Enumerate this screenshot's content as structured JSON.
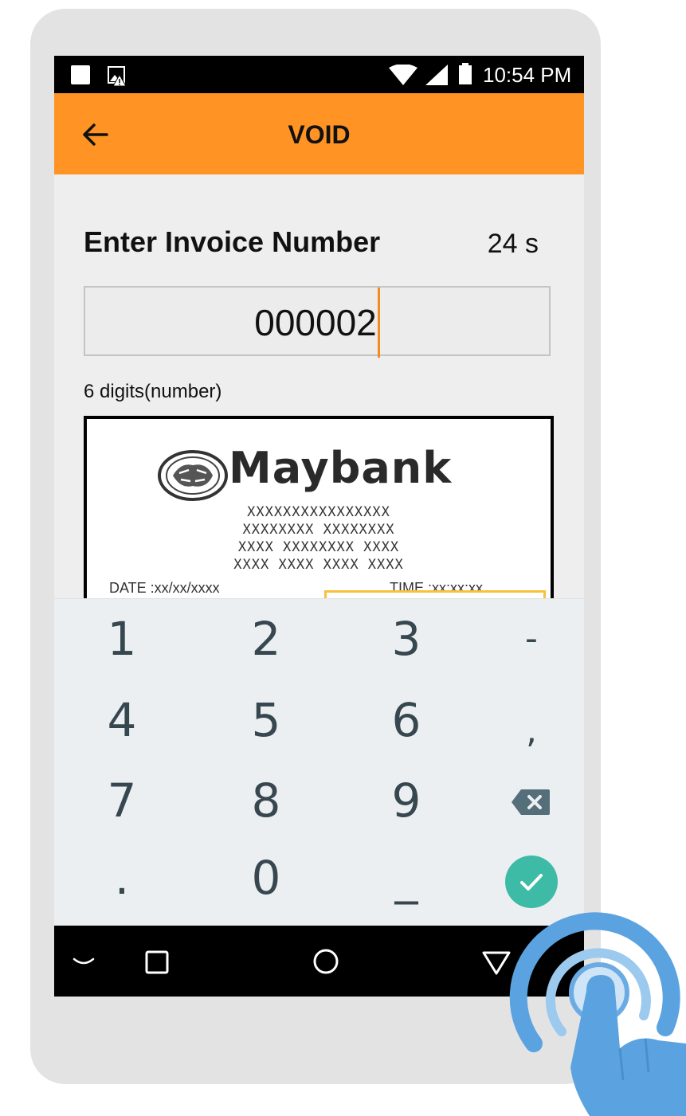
{
  "status_bar": {
    "time": "10:54 PM",
    "icons": [
      "notification-square-icon",
      "image-alert-icon",
      "wifi-icon",
      "cell-signal-icon",
      "battery-icon"
    ]
  },
  "app_bar": {
    "title": "VOID",
    "back_icon": "arrow-left-icon"
  },
  "form": {
    "prompt": "Enter Invoice Number",
    "timer": "24 s",
    "invoice_value": "000002",
    "hint": "6 digits(number)"
  },
  "receipt_preview": {
    "bank_name": "Maybank",
    "masked_lines": [
      "XXXXXXXXXXXXXXXX",
      "XXXXXXXX XXXXXXXX",
      "XXXX XXXXXXXX XXXX",
      "XXXX XXXX XXXX XXXX"
    ],
    "date_label": "DATE :xx/xx/xxxx",
    "time_label": "TIME :xx:xx:xx"
  },
  "keypad": {
    "keys": [
      "1",
      "2",
      "3",
      "-",
      "4",
      "5",
      "6",
      ",",
      "7",
      "8",
      "9",
      ".",
      "0",
      "_"
    ],
    "backspace_icon": "backspace-icon",
    "enter_icon": "checkmark-icon",
    "colors": {
      "key_text": "#37474f",
      "enter": "#3dbba7"
    }
  },
  "nav_bar": {
    "icons": [
      "keyboard-hide-icon",
      "recents-square-icon",
      "home-circle-icon",
      "back-triangle-icon"
    ]
  },
  "overlay": {
    "icon": "tap-hand-icon"
  },
  "colors": {
    "accent": "#ff9424",
    "cursor": "#f28c1c",
    "touch": "#5ba3e0"
  }
}
